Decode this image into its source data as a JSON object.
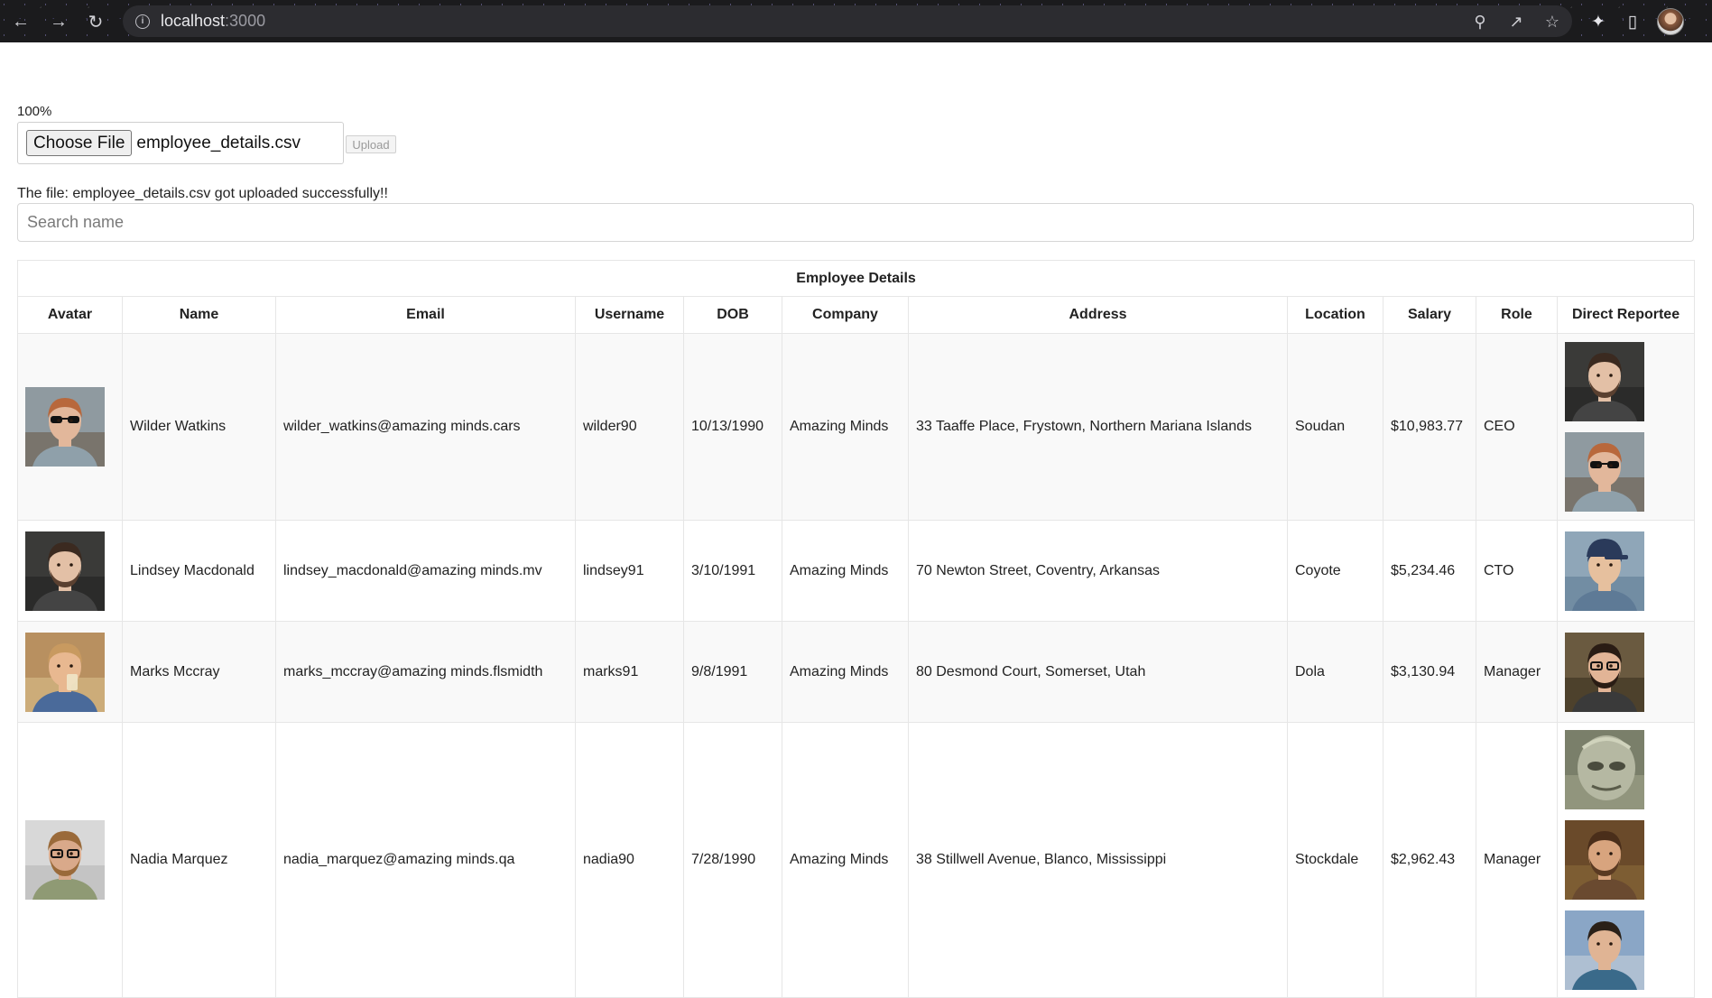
{
  "browser": {
    "url_host": "localhost",
    "url_port": ":3000"
  },
  "upload": {
    "progress": "100%",
    "choose_label": "Choose File",
    "file_name": "employee_details.csv",
    "upload_label": "Upload",
    "message": "The file: employee_details.csv got uploaded successfully!!"
  },
  "search": {
    "placeholder": "Search name",
    "value": ""
  },
  "table": {
    "title": "Employee Details",
    "headers": [
      "Avatar",
      "Name",
      "Email",
      "Username",
      "DOB",
      "Company",
      "Address",
      "Location",
      "Salary",
      "Role",
      "Direct Reportee"
    ],
    "rows": [
      {
        "avatar": "person-sunglasses",
        "name": "Wilder Watkins",
        "email": "wilder_watkins@amazing minds.cars",
        "username": "wilder90",
        "dob": "10/13/1990",
        "company": "Amazing Minds",
        "address": "33 Taaffe Place, Frystown, Northern Mariana Islands",
        "location": "Soudan",
        "salary": "$10,983.77",
        "role": "CEO",
        "reportees": [
          "person-dark-bg",
          "person-sunglasses"
        ]
      },
      {
        "avatar": "person-dark-bg",
        "name": "Lindsey Macdonald",
        "email": "lindsey_macdonald@amazing minds.mv",
        "username": "lindsey91",
        "dob": "3/10/1991",
        "company": "Amazing Minds",
        "address": "70 Newton Street, Coventry, Arkansas",
        "location": "Coyote",
        "salary": "$5,234.46",
        "role": "CTO",
        "reportees": [
          "person-cap"
        ]
      },
      {
        "avatar": "person-drinking",
        "name": "Marks Mccray",
        "email": "marks_mccray@amazing minds.flsmidth",
        "username": "marks91",
        "dob": "9/8/1991",
        "company": "Amazing Minds",
        "address": "80 Desmond Court, Somerset, Utah",
        "location": "Dola",
        "salary": "$3,130.94",
        "role": "Manager",
        "reportees": [
          "person-glasses-beard"
        ]
      },
      {
        "avatar": "person-green-sweater",
        "name": "Nadia Marquez",
        "email": "nadia_marquez@amazing minds.qa",
        "username": "nadia90",
        "dob": "7/28/1990",
        "company": "Amazing Minds",
        "address": "38 Stillwell Avenue, Blanco, Mississippi",
        "location": "Stockdale",
        "salary": "$2,962.43",
        "role": "Manager",
        "reportees": [
          "alien-sculpture",
          "person-curly-hair",
          "person-city"
        ]
      }
    ]
  },
  "colors": {
    "chrome_bg": "#1b1b1d",
    "omnibox_bg": "#2c2c30",
    "row_alt": "#f9f9f9",
    "border": "#e6e6e6"
  }
}
